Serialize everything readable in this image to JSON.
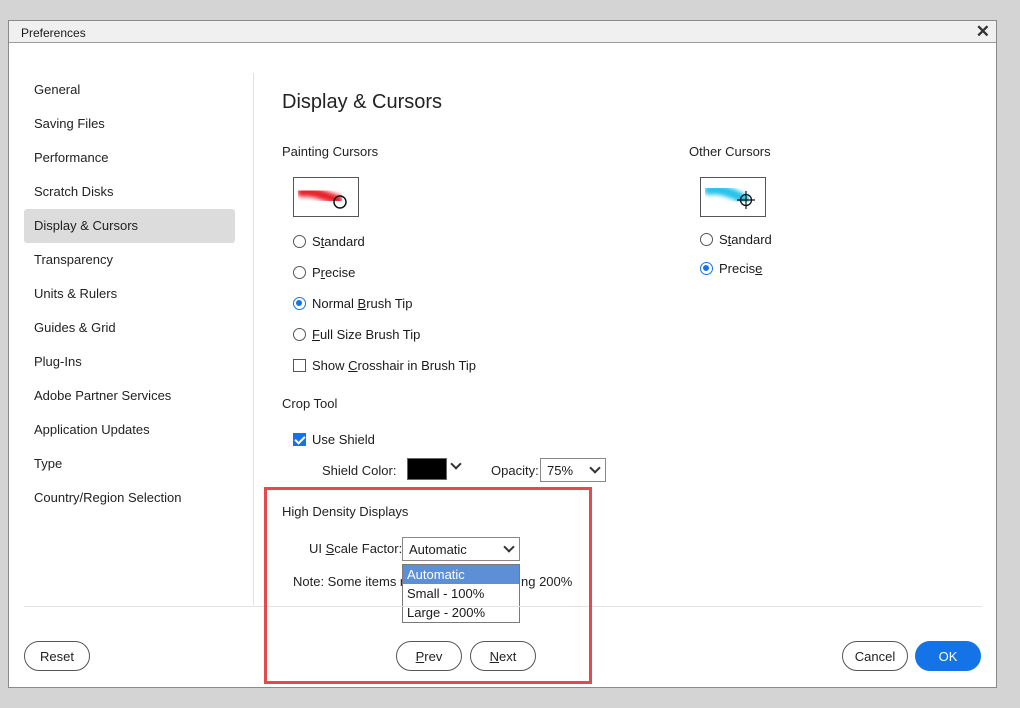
{
  "window": {
    "title": "Preferences",
    "close_symbol": "✕"
  },
  "sidebar": {
    "items": [
      {
        "label": "General"
      },
      {
        "label": "Saving Files"
      },
      {
        "label": "Performance"
      },
      {
        "label": "Scratch Disks"
      },
      {
        "label": "Display & Cursors",
        "selected": true
      },
      {
        "label": "Transparency"
      },
      {
        "label": "Units & Rulers"
      },
      {
        "label": "Guides & Grid"
      },
      {
        "label": "Plug-Ins"
      },
      {
        "label": "Adobe Partner Services"
      },
      {
        "label": "Application Updates"
      },
      {
        "label": "Type"
      },
      {
        "label": "Country/Region Selection"
      }
    ]
  },
  "main": {
    "heading": "Display & Cursors",
    "painting": {
      "label": "Painting Cursors",
      "options": {
        "standard_pre": "S",
        "standard_u": "t",
        "standard_post": "andard",
        "precise_pre": "P",
        "precise_u": "r",
        "precise_post": "ecise",
        "normal_pre": "Normal ",
        "normal_u": "B",
        "normal_post": "rush Tip",
        "full_pre": "",
        "full_u": "F",
        "full_post": "ull Size Brush Tip"
      },
      "selected": "Normal Brush Tip",
      "crosshair_pre": "Show ",
      "crosshair_u": "C",
      "crosshair_post": "rosshair in Brush Tip",
      "crosshair_checked": false
    },
    "other": {
      "label": "Other Cursors",
      "standard_pre": "S",
      "standard_u": "t",
      "standard_post": "andard",
      "precise_pre": "Precis",
      "precise_u": "e",
      "precise_post": "",
      "selected": "Precise"
    },
    "crop": {
      "label": "Crop Tool",
      "use_shield": "Use Shield",
      "use_shield_checked": true,
      "shield_color_label": "Shield Color:",
      "shield_color": "#000000",
      "opacity_label": "Opacity:",
      "opacity_value": "75%"
    },
    "hdd": {
      "label": "High Density Displays",
      "scale_label_pre": "UI ",
      "scale_label_u": "S",
      "scale_label_post": "cale Factor:",
      "scale_value": "Automatic",
      "note_left": "Note: Some items m",
      "note_right": "ng 200%",
      "options": [
        "Automatic",
        "Small - 100%",
        "Large - 200%"
      ]
    }
  },
  "footer": {
    "reset": "Reset",
    "prev_u": "P",
    "prev_post": "rev",
    "next_u": "N",
    "next_post": "ext",
    "cancel": "Cancel",
    "ok": "OK"
  },
  "colors": {
    "accent": "#1473e6",
    "highlight": "#e5484d",
    "dropdown_selected": "#5c8fd6"
  }
}
